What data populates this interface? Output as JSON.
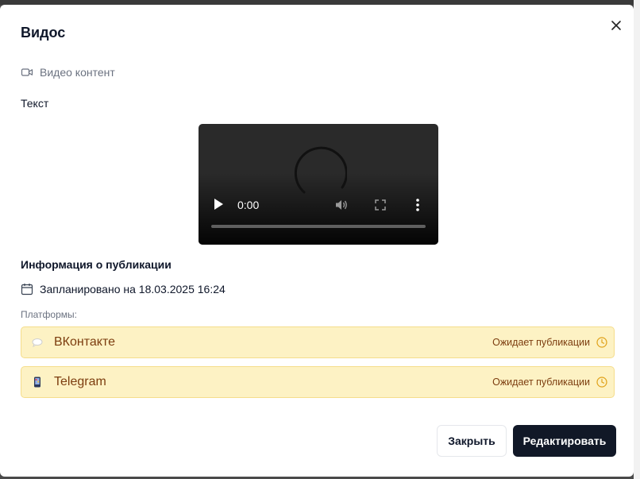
{
  "modal": {
    "title": "Видос",
    "content_type_label": "Видео контент",
    "content_type_icon": "video-camera-icon",
    "text_label": "Текст",
    "video": {
      "current_time": "0:00",
      "progress": 0
    },
    "publication": {
      "section_title": "Информация о публикации",
      "scheduled_text": "Запланировано на 18.03.2025 16:24",
      "platforms_label": "Платформы:",
      "platforms": [
        {
          "name": "ВКонтакте",
          "icon": "speech-bubble-icon",
          "status": "Ожидает публикации",
          "status_icon": "clock-icon"
        },
        {
          "name": "Telegram",
          "icon": "mobile-phone-icon",
          "status": "Ожидает публикации",
          "status_icon": "clock-icon"
        }
      ]
    },
    "buttons": {
      "close_label": "Закрыть",
      "edit_label": "Редактировать"
    }
  },
  "colors": {
    "platform_bg": "#fdf2c4",
    "platform_border": "#f5dd8b",
    "platform_text": "#7c3d0f",
    "primary_button": "#111827"
  }
}
